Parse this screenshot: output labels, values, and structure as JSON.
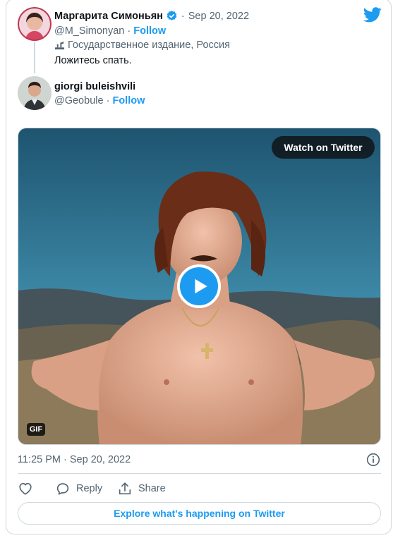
{
  "colors": {
    "accent": "#1d9bf0",
    "muted": "#536471",
    "border": "#cfd9de"
  },
  "tweet": {
    "author_name": "Маргарита Симоньян",
    "verified": true,
    "date_sep": "·",
    "date": "Sep 20, 2022",
    "handle": "@M_Simonyan",
    "follow_sep": "·",
    "follow_label": "Follow",
    "label_icon": "state-media-icon",
    "label_text": "Государственное издание, Россия",
    "text": "Ложитесь спать."
  },
  "reply": {
    "author_name": "giorgi buleishvili",
    "handle": "@Geobule",
    "follow_sep": "·",
    "follow_label": "Follow"
  },
  "media": {
    "watch_label": "Watch on Twitter",
    "badge": "GIF"
  },
  "footer": {
    "timestamp": "11:25 PM · Sep 20, 2022",
    "info_icon": "info-icon",
    "like_icon": "heart-icon",
    "reply_label": "Reply",
    "share_label": "Share",
    "explore_label": "Explore what's happening on Twitter"
  }
}
